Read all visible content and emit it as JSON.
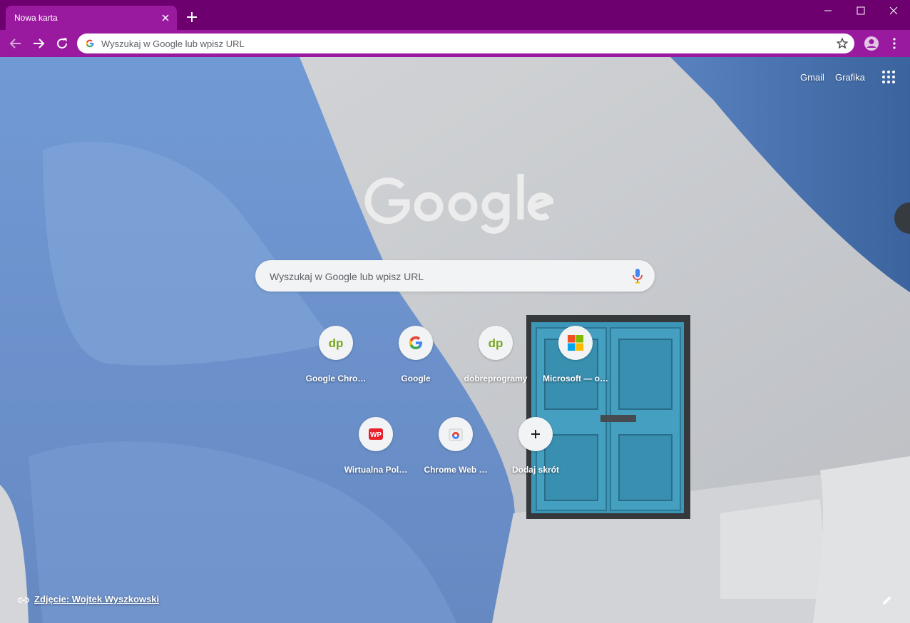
{
  "tab": {
    "title": "Nowa karta"
  },
  "omnibox": {
    "placeholder": "Wyszukaj w Google lub wpisz URL"
  },
  "header_links": {
    "gmail": "Gmail",
    "images": "Grafika"
  },
  "search": {
    "placeholder": "Wyszukaj w Google lub wpisz URL"
  },
  "shortcuts": [
    {
      "title": "Google Chro…",
      "icon": "dobreprogramy-icon"
    },
    {
      "title": "Google",
      "icon": "google-g-icon"
    },
    {
      "title": "dobreprogramy",
      "icon": "dobreprogramy-icon"
    },
    {
      "title": "Microsoft — o…",
      "icon": "microsoft-icon"
    },
    {
      "title": "Wirtualna Pol…",
      "icon": "wp-icon"
    },
    {
      "title": "Chrome Web …",
      "icon": "chrome-web-store-icon"
    },
    {
      "title": "Dodaj skrót",
      "icon": "plus-icon"
    }
  ],
  "attribution": {
    "text": "Zdjęcie: Wojtek Wyszkowski"
  },
  "colors": {
    "frame": "#6d006e",
    "toolbar": "#9a1a9f",
    "sky_blue": "#7aa3de",
    "wall_white": "#d8dbdf",
    "door_blue": "#3e9dc0"
  }
}
